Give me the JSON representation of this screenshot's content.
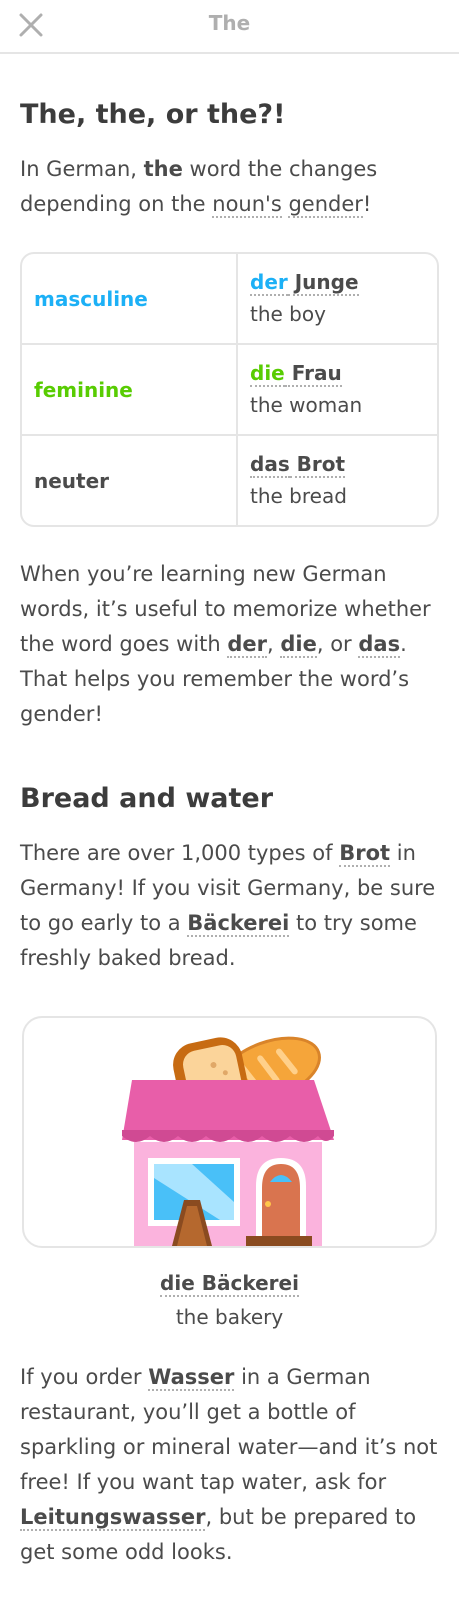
{
  "header": {
    "title": "The",
    "close_icon": "close-icon"
  },
  "section1": {
    "heading": "The, the, or the?!",
    "intro_prefix": "In German, ",
    "intro_bold": "the",
    "intro_middle": " word the changes depending on the ",
    "intro_nouns": "noun's",
    "intro_space": " ",
    "intro_gender": "gender",
    "intro_end": "!"
  },
  "gender_table": {
    "rows": [
      {
        "gender": "masculine",
        "article": "der",
        "noun": " Junge",
        "gloss": "the boy",
        "color": "#1cb0f6"
      },
      {
        "gender": "feminine",
        "article": "die",
        "noun": " Frau",
        "gloss": "the woman",
        "color": "#58cc02"
      },
      {
        "gender": "neuter",
        "article": "das",
        "noun": " Brot",
        "gloss": "the bread",
        "color": "#4b4b4b"
      }
    ]
  },
  "paragraph2": {
    "t1": "When you’re learning new German words, it’s useful to memorize whether the word goes with ",
    "der": "der",
    "t2": ", ",
    "die": "die",
    "t3": ", or ",
    "das": "das",
    "t4": ". That helps you remember the word’s gender!"
  },
  "section2": {
    "heading": "Bread and water",
    "t1": "There are over 1,000 types of ",
    "brot": "Brot",
    "t2": " in Germany! If you visit Germany, be sure to go early to a ",
    "baeckerei": "Bäckerei",
    "t3": " to try some freshly baked bread."
  },
  "image_caption": {
    "term": "die Bäckerei",
    "gloss": "the bakery",
    "illustration": "bakery-illustration"
  },
  "paragraph4": {
    "t1": "If you order ",
    "wasser": "Wasser",
    "t2": " in a German restaurant, you’ll get a bottle of sparkling or mineral water—and it’s not free! If you want tap water, ask for ",
    "leitungswasser": "Leitungswasser",
    "t3": ", but be prepared to get some odd looks."
  }
}
